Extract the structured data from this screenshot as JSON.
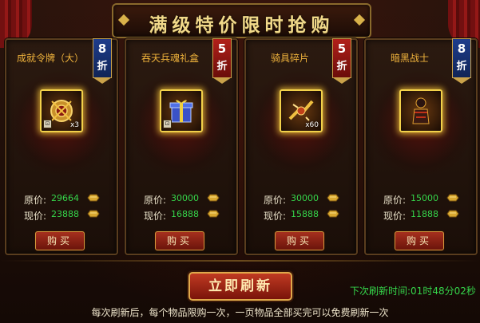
{
  "title": "满级特价限时抢购",
  "labels": {
    "original_price": "原价:",
    "current_price": "现价:",
    "buy": "购买"
  },
  "ribbon_suffix": "折",
  "items": [
    {
      "name": "成就令牌（大）",
      "discount": "8",
      "ribbon_color": "#1e3d8c",
      "original_price": "29664",
      "current_price": "23888",
      "quantity": "x3",
      "locked": true,
      "icon": "token-icon"
    },
    {
      "name": "吞天兵魂礼盒",
      "discount": "5",
      "ribbon_color": "#b2201a",
      "original_price": "30000",
      "current_price": "16888",
      "quantity": "",
      "locked": true,
      "icon": "gift-box-icon"
    },
    {
      "name": "骑具碎片",
      "discount": "5",
      "ribbon_color": "#b2201a",
      "original_price": "30000",
      "current_price": "15888",
      "quantity": "x60",
      "locked": false,
      "icon": "mount-fragment-icon"
    },
    {
      "name": "暗黑战士",
      "discount": "8",
      "ribbon_color": "#1e3d8c",
      "original_price": "15000",
      "current_price": "11888",
      "quantity": "",
      "locked": false,
      "icon": "dark-warrior-icon"
    }
  ],
  "refresh_button": "立即刷新",
  "timer": {
    "label": "下次刷新时间:",
    "value": "01时48分02秒"
  },
  "footer_note": "每次刷新后，每个物品限购一次，一页物品全部买完可以免费刷新一次",
  "colors": {
    "price_green": "#35d44a",
    "name_orange": "#f0b33c",
    "title_gold": "#f1d98a"
  }
}
